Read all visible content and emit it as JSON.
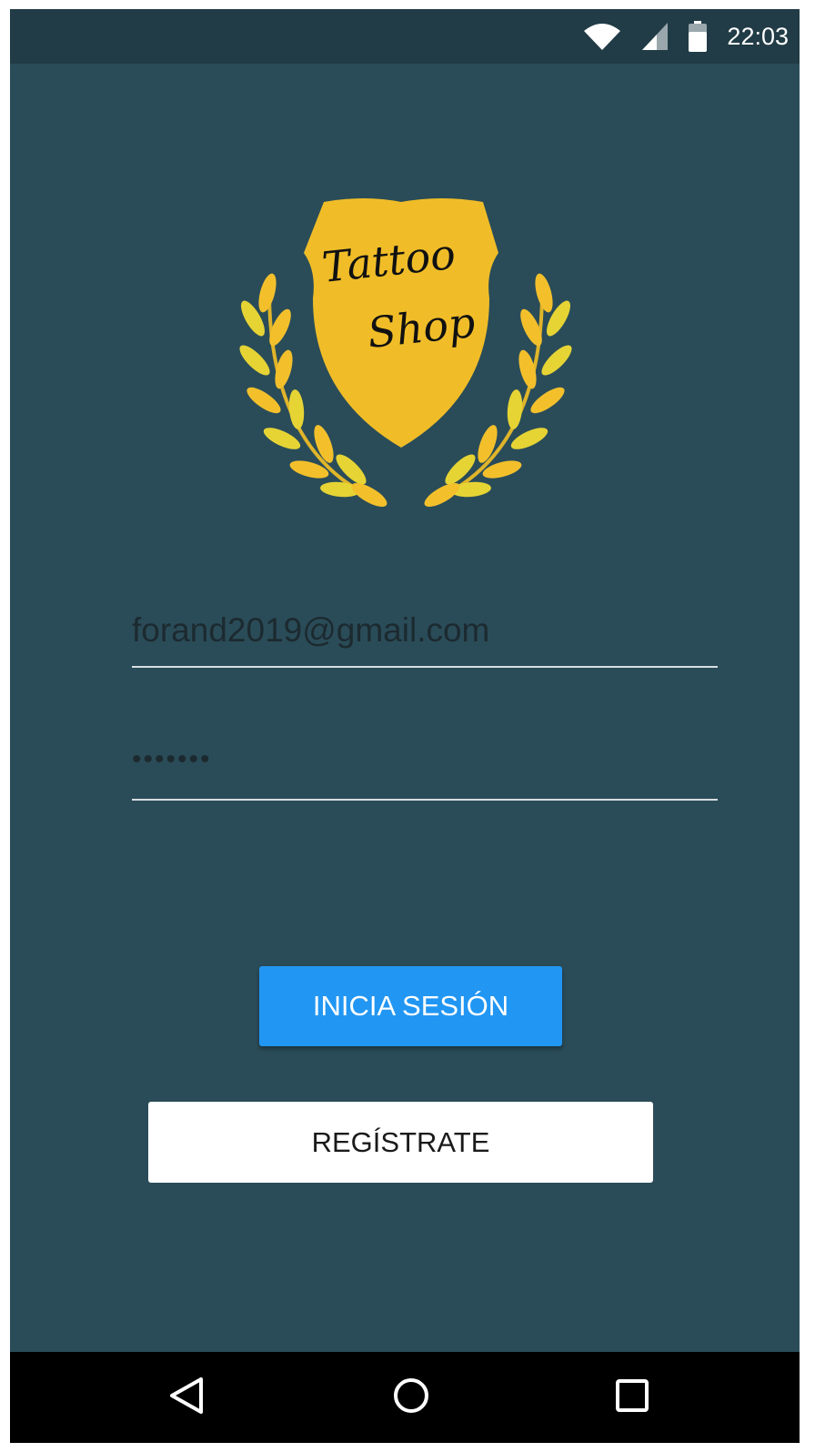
{
  "status_bar": {
    "time": "22:03",
    "icons": [
      "wifi-icon",
      "signal-icon",
      "battery-icon"
    ]
  },
  "logo": {
    "line1": "Tattoo",
    "line2": "Shop",
    "colors": {
      "shield": "#f0bd28",
      "laurel": [
        "#f3c02c",
        "#e6d435"
      ],
      "text": "#111111"
    }
  },
  "form": {
    "email_value": "forand2019@gmail.com",
    "password_value": "•••••••"
  },
  "buttons": {
    "login_label": "INICIA SESIÓN",
    "register_label": "REGÍSTRATE"
  },
  "navigation": {
    "icons": [
      "back-icon",
      "home-icon",
      "recents-icon"
    ]
  },
  "colors": {
    "background": "#2a4c58",
    "status_bar": "#213c46",
    "primary_button": "#2196f3",
    "secondary_button": "#ffffff",
    "nav_bar": "#000000"
  }
}
